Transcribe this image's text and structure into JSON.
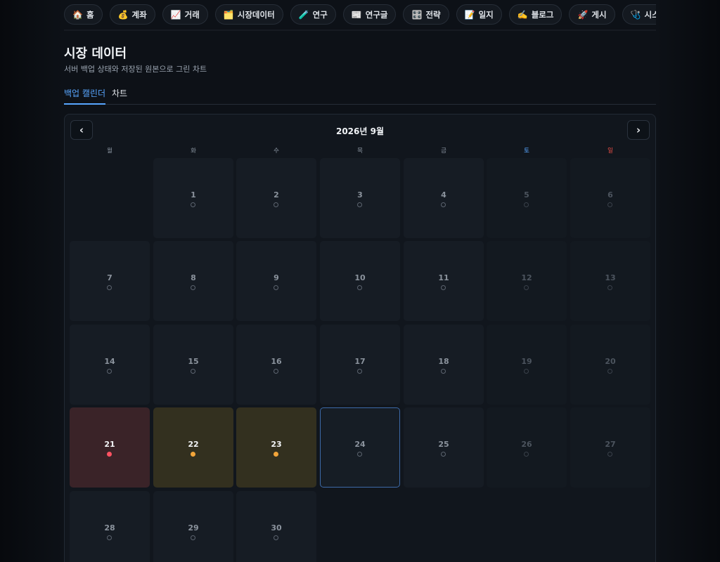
{
  "nav": [
    {
      "icon": "🏠",
      "icon_name": "home-icon",
      "label": "홈"
    },
    {
      "icon": "💰",
      "icon_name": "money-bag-icon",
      "label": "계좌"
    },
    {
      "icon": "📈",
      "icon_name": "chart-up-icon",
      "label": "거래"
    },
    {
      "icon": "🗂️",
      "icon_name": "folder-icon",
      "label": "시장데이터"
    },
    {
      "icon": "🧪",
      "icon_name": "test-tube-icon",
      "label": "연구"
    },
    {
      "icon": "📰",
      "icon_name": "newspaper-icon",
      "label": "연구글"
    },
    {
      "icon": "🎛️",
      "icon_name": "control-knobs-icon",
      "label": "전략"
    },
    {
      "icon": "📝",
      "icon_name": "memo-icon",
      "label": "일지"
    },
    {
      "icon": "✍️",
      "icon_name": "writing-hand-icon",
      "label": "블로그"
    },
    {
      "icon": "🚀",
      "icon_name": "rocket-icon",
      "label": "게시"
    },
    {
      "icon": "🩺",
      "icon_name": "stethoscope-icon",
      "label": "시스템"
    }
  ],
  "page": {
    "title": "시장 데이터",
    "subtitle": "서버 백업 상태와 저장된 원본으로 그린 차트"
  },
  "tabs": [
    {
      "label": "백업 캘린더",
      "active": true
    },
    {
      "label": "차트",
      "active": false
    }
  ],
  "calendar": {
    "month_label": "2026년 9월",
    "prev_label": "‹",
    "next_label": "›",
    "weekdays": [
      "월",
      "화",
      "수",
      "목",
      "금",
      "토",
      "일"
    ],
    "first_weekday_index": 1,
    "days_in_month": 30,
    "today": 24,
    "status": {
      "21": "red",
      "22": "amber",
      "23": "amber"
    },
    "colors": {
      "red": "#ff5262",
      "amber": "#f2a53a",
      "today_border": "#3d6aa8",
      "accent": "#58a6ff",
      "sunday": "#f85149"
    }
  }
}
